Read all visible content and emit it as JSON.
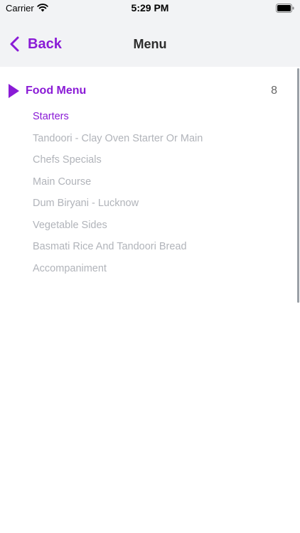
{
  "status_bar": {
    "carrier": "Carrier",
    "time": "5:29 PM"
  },
  "nav": {
    "back_label": "Back",
    "title": "Menu"
  },
  "menu": {
    "title": "Food Menu",
    "count": "8",
    "items": [
      {
        "label": "Starters",
        "active": true
      },
      {
        "label": "Tandoori - Clay Oven Starter Or Main",
        "active": false
      },
      {
        "label": "Chefs Specials",
        "active": false
      },
      {
        "label": "Main Course",
        "active": false
      },
      {
        "label": "Dum Biryani - Lucknow",
        "active": false
      },
      {
        "label": "Vegetable Sides",
        "active": false
      },
      {
        "label": "Basmati Rice And Tandoori Bread",
        "active": false
      },
      {
        "label": "Accompaniment",
        "active": false
      }
    ]
  },
  "colors": {
    "accent": "#8a1bd6",
    "inactive_text": "#b1b4ba",
    "bar_bg": "#f2f3f5"
  },
  "icons": {
    "back": "chevron-left-icon",
    "expand": "triangle-right-icon",
    "wifi": "wifi-icon",
    "battery": "battery-icon"
  }
}
